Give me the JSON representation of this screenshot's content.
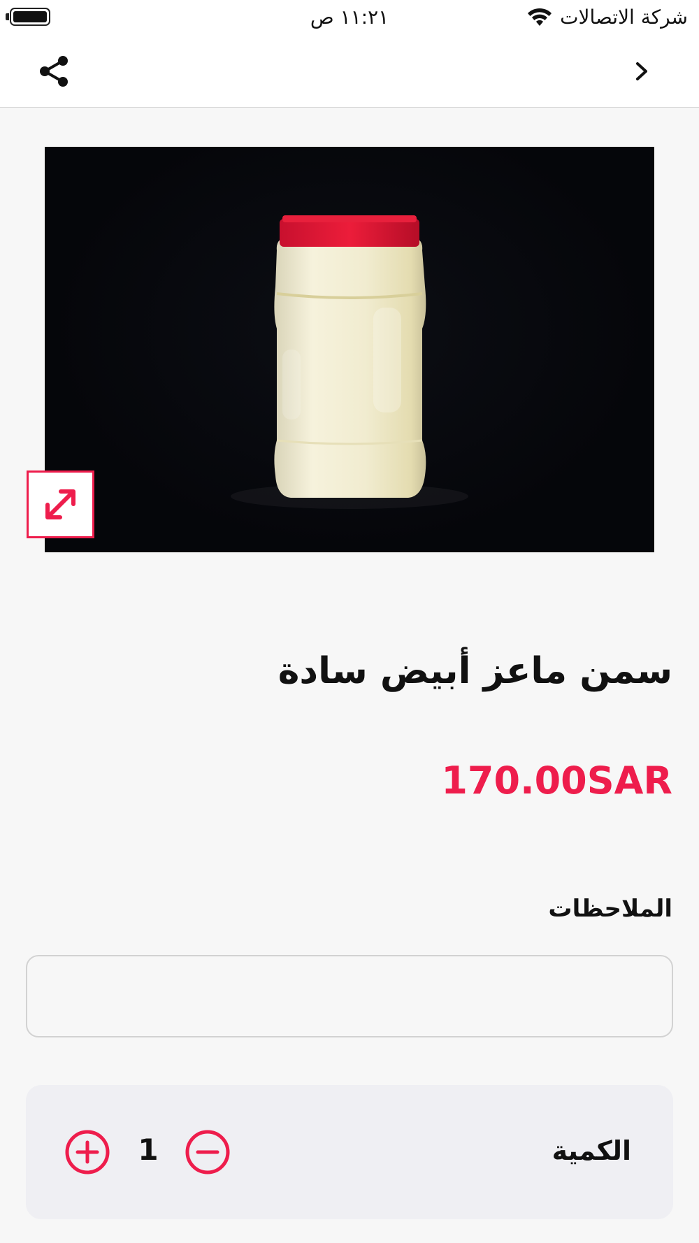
{
  "status_bar": {
    "carrier": "شركة الاتصالات",
    "time": "١١:٢١ ص"
  },
  "nav": {
    "share_icon": "share-icon",
    "back_icon": "chevron-right-icon"
  },
  "product": {
    "title": "سمن ماعز أبيض سادة",
    "price": "170.00SAR",
    "image_icon": "expand-icon"
  },
  "notes": {
    "label": "الملاحظات",
    "value": "",
    "placeholder": ""
  },
  "quantity": {
    "label": "الكمية",
    "value": "1"
  },
  "colors": {
    "accent": "#ee1d4c",
    "background": "#f7f7f7",
    "panel": "#efeff3"
  }
}
